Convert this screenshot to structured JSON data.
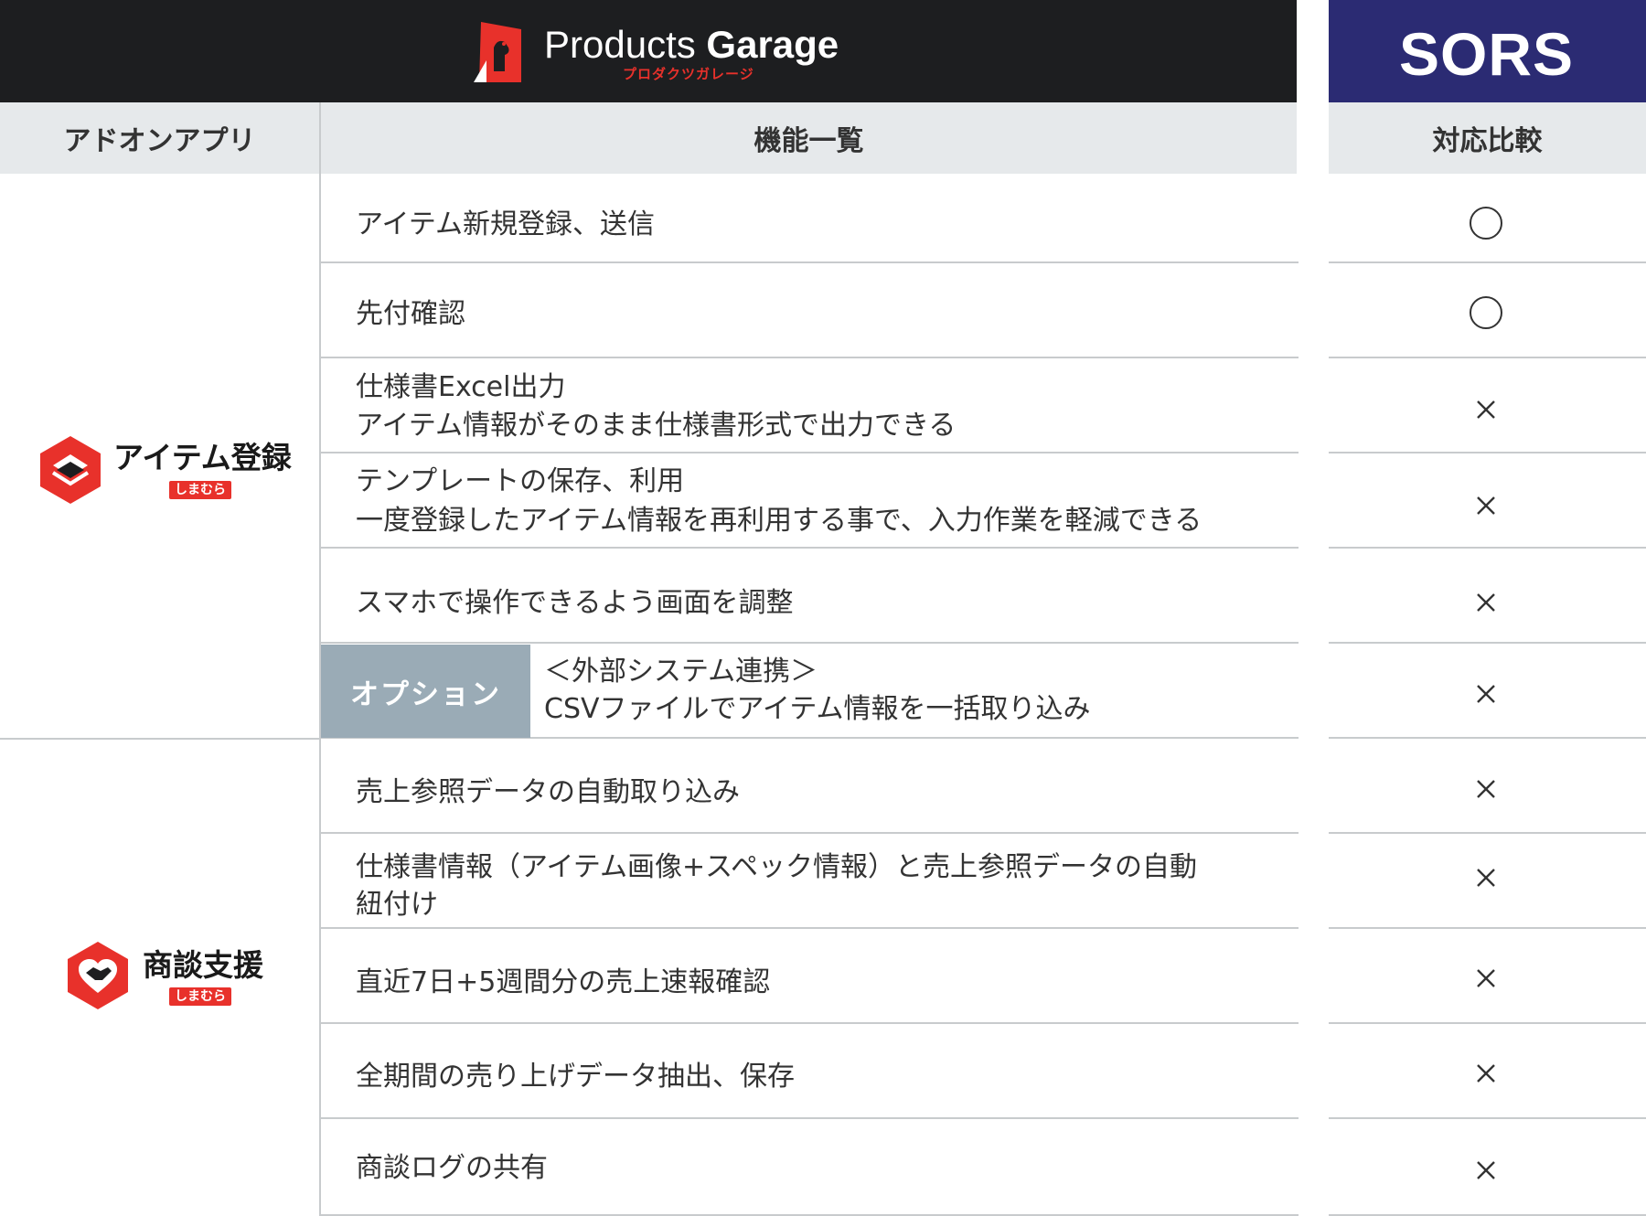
{
  "brand": {
    "title_regular": "Products",
    "title_bold": "Garage",
    "subtitle": "プロダクツガレージ",
    "competitor_logo": "SORS",
    "accent_color": "#e8312b",
    "header_color": "#1d1e20",
    "competitor_color": "#2b2b73"
  },
  "columns": {
    "addon": "アドオンアプリ",
    "features": "機能一覧",
    "comparison": "対応比較"
  },
  "addons": [
    {
      "name": "アイテム登録",
      "tag": "しまむら",
      "icon": "stack-icon"
    },
    {
      "name": "商談支援",
      "tag": "しまむら",
      "icon": "handshake-icon"
    }
  ],
  "option_label": "オプション",
  "rows": [
    {
      "lines": [
        "アイテム新規登録、送信"
      ],
      "mark": "circle"
    },
    {
      "lines": [
        "先付確認"
      ],
      "mark": "circle"
    },
    {
      "lines": [
        "仕様書Excel出力",
        "アイテム情報がそのまま仕様書形式で出力できる"
      ],
      "mark": "cross"
    },
    {
      "lines": [
        "テンプレートの保存、利用",
        "一度登録したアイテム情報を再利用する事で、入力作業を軽減できる"
      ],
      "mark": "cross"
    },
    {
      "lines": [
        "スマホで操作できるよう画面を調整"
      ],
      "mark": "cross"
    },
    {
      "lines": [
        "＜外部システム連携＞",
        "CSVファイルでアイテム情報を一括取り込み"
      ],
      "mark": "cross"
    },
    {
      "lines": [
        "売上参照データの自動取り込み"
      ],
      "mark": "cross"
    },
    {
      "lines": [
        "仕様書情報（アイテム画像+スペック情報）と売上参照データの自動",
        "紐付け"
      ],
      "mark": "cross"
    },
    {
      "lines": [
        "直近7日+5週間分の売上速報確認"
      ],
      "mark": "cross"
    },
    {
      "lines": [
        "全期間の売り上げデータ抽出、保存"
      ],
      "mark": "cross"
    },
    {
      "lines": [
        "商談ログの共有"
      ],
      "mark": "cross"
    }
  ]
}
